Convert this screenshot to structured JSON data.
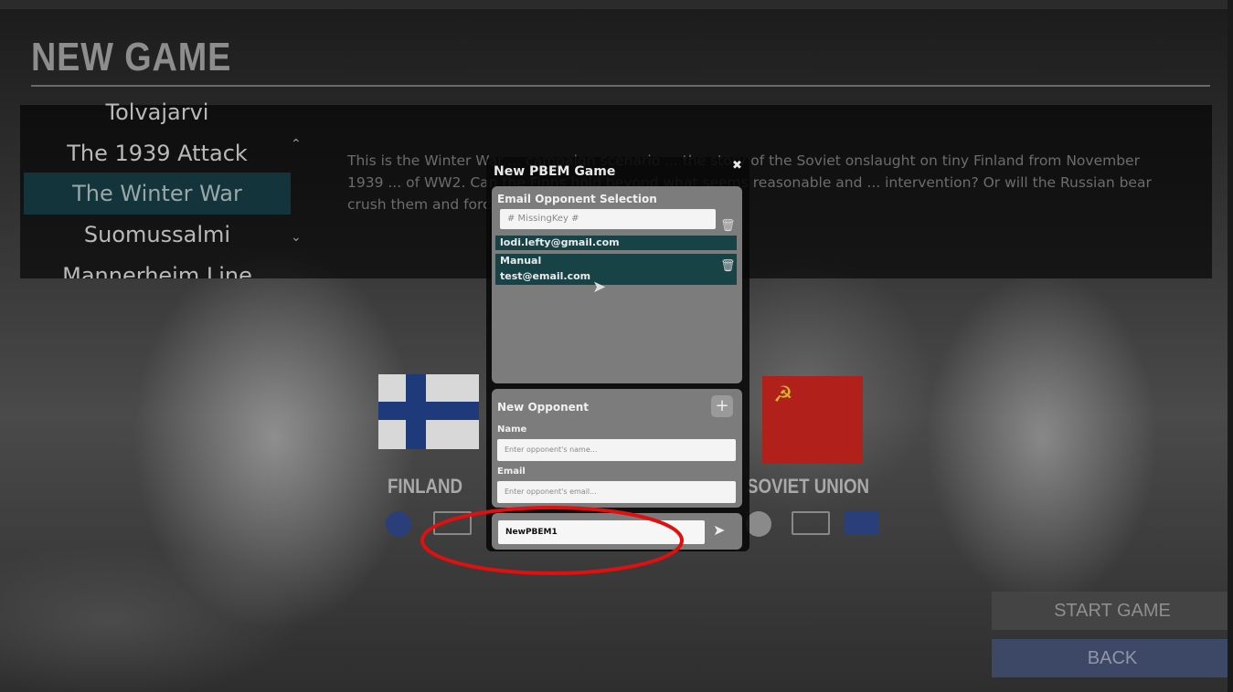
{
  "screen": {
    "title": "NEW GAME"
  },
  "scenarios": {
    "items": [
      {
        "label": "Tolvajarvi"
      },
      {
        "label": "The 1939 Attack"
      },
      {
        "label": "The Winter War",
        "selected": true
      },
      {
        "label": "Suomussalmi"
      },
      {
        "label": "Mannerheim Line"
      }
    ],
    "scroll_up_icon": "chevron-up-icon",
    "scroll_down_icon": "chevron-down-icon",
    "description": "This is the Winter War ... campaign scenario ... the story of the Soviet onslaught on tiny Finland from November 1939 ... of WW2. Can the Finns hold beyond what seems reasonable and ... intervention? Or will the Russian bear crush them and force them to lose ..."
  },
  "sides": {
    "left": {
      "label": "FINLAND",
      "flag_color": "#1e3a7a"
    },
    "right": {
      "label": "SOVIET UNION",
      "flag_color": "#b2201c"
    },
    "vs_icon": "versus-mark"
  },
  "dialog": {
    "title": "New PBEM Game",
    "close_icon": "close-icon",
    "selection": {
      "heading": "Email Opponent Selection",
      "search_placeholder": "# MissingKey #",
      "opponents": [
        {
          "email": "lodi.lefty@gmail.com"
        },
        {
          "name": "Manual",
          "email": "test@email.com"
        }
      ],
      "delete_icon": "trash-icon"
    },
    "new_opponent": {
      "heading": "New Opponent",
      "add_icon": "plus-icon",
      "name_label": "Name",
      "name_placeholder": "Enter opponent's name...",
      "email_label": "Email",
      "email_placeholder": "Enter opponent's email..."
    },
    "game_name_value": "NewPBEM1",
    "send_icon": "send-arrow-icon"
  },
  "buttons": {
    "start": "START GAME",
    "back": "BACK"
  },
  "colors": {
    "selected_row": "#174347",
    "highlight_ring": "#e01010",
    "back_button": "#3c4866"
  }
}
